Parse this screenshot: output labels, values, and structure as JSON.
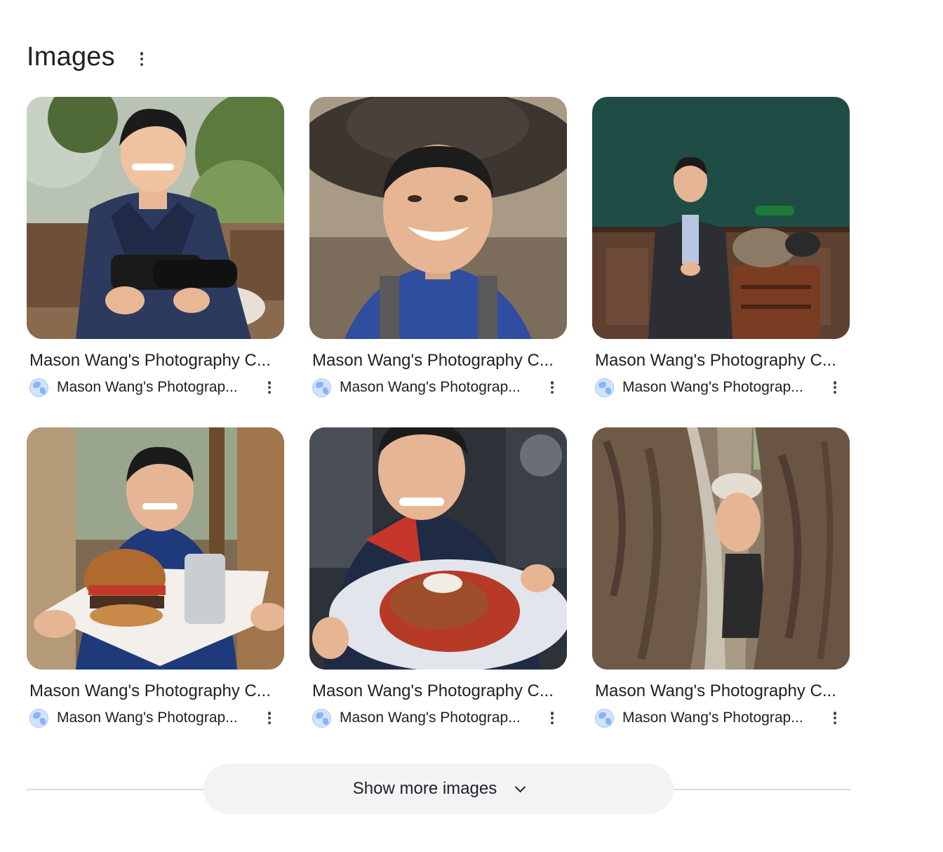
{
  "section": {
    "title": "Images"
  },
  "cards": [
    {
      "title": "Mason Wang's Photography C...",
      "source": "Mason Wang's Photograp...",
      "image": "photo-camera-outdoors"
    },
    {
      "title": "Mason Wang's Photography C...",
      "source": "Mason Wang's Photograp...",
      "image": "photo-cowboy-hat"
    },
    {
      "title": "Mason Wang's Photography C...",
      "source": "Mason Wang's Photograp...",
      "image": "photo-suit-green-wall"
    },
    {
      "title": "Mason Wang's Photography C...",
      "source": "Mason Wang's Photograp...",
      "image": "photo-burger-tray"
    },
    {
      "title": "Mason Wang's Photography C...",
      "source": "Mason Wang's Photograp...",
      "image": "photo-pasta-plate"
    },
    {
      "title": "Mason Wang's Photography C...",
      "source": "Mason Wang's Photograp...",
      "image": "photo-tree-trunk"
    }
  ],
  "footer": {
    "show_more_label": "Show more images"
  },
  "icons": {
    "menu": "more-vert-icon",
    "favicon": "globe-icon",
    "expand": "chevron-down-icon"
  }
}
